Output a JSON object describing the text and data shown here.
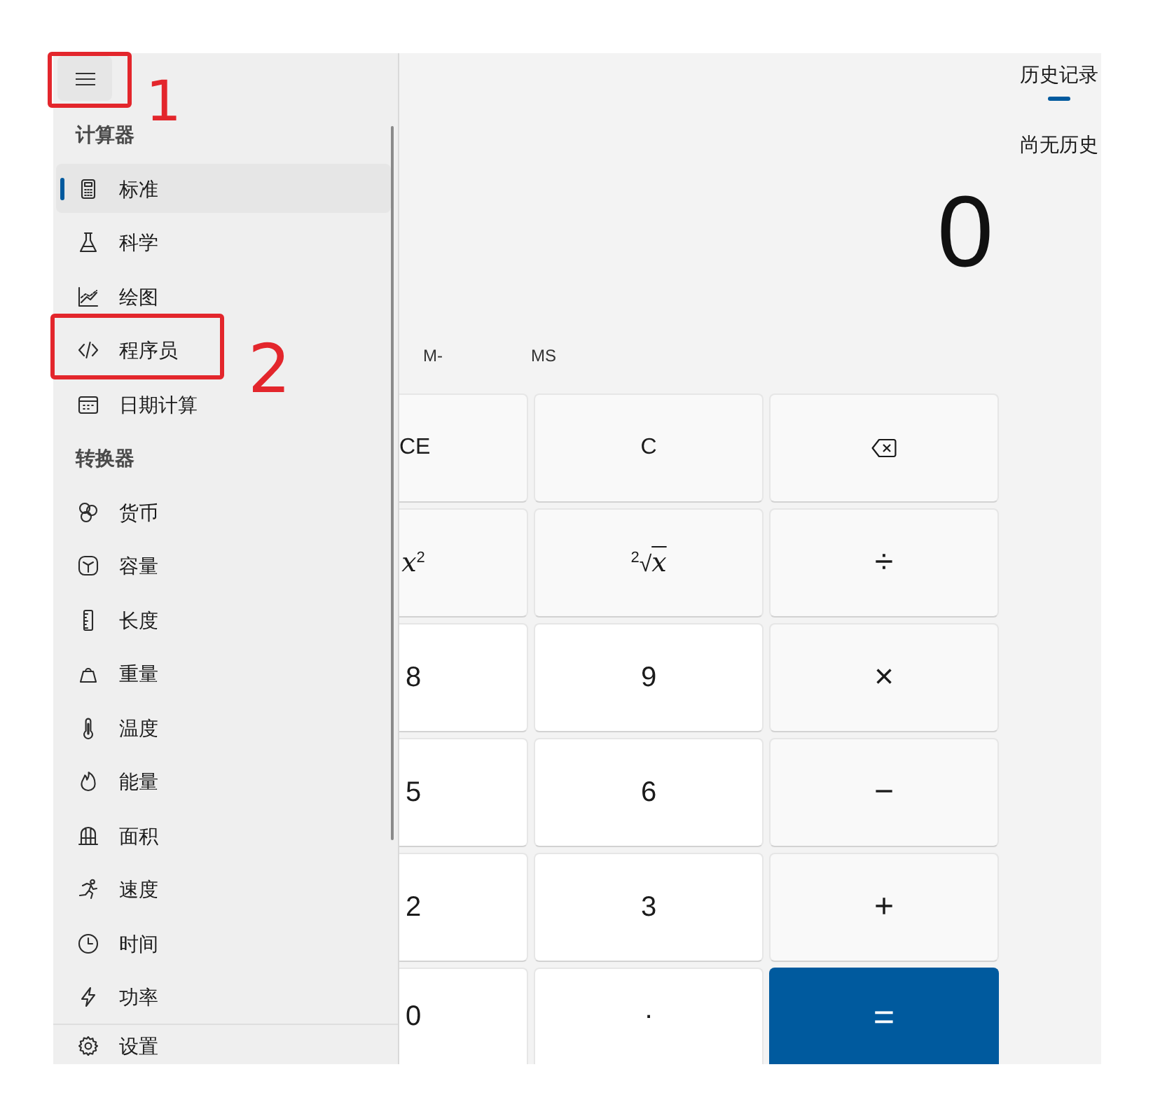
{
  "nav": {
    "menu_button": {
      "annotation": "1"
    },
    "sections": [
      {
        "title": "计算器",
        "items": [
          {
            "label": "标准",
            "selected": true
          },
          {
            "label": "科学",
            "selected": false
          },
          {
            "label": "绘图",
            "selected": false
          },
          {
            "label": "程序员",
            "selected": false,
            "annotation": "2"
          },
          {
            "label": "日期计算",
            "selected": false
          }
        ]
      },
      {
        "title": "转换器",
        "items": [
          {
            "label": "货币",
            "selected": false
          },
          {
            "label": "容量",
            "selected": false
          },
          {
            "label": "长度",
            "selected": false
          },
          {
            "label": "重量",
            "selected": false
          },
          {
            "label": "温度",
            "selected": false
          },
          {
            "label": "能量",
            "selected": false
          },
          {
            "label": "面积",
            "selected": false
          },
          {
            "label": "速度",
            "selected": false
          },
          {
            "label": "时间",
            "selected": false
          },
          {
            "label": "功率",
            "selected": false
          }
        ]
      }
    ],
    "footer_item": {
      "label": "设置"
    }
  },
  "display": {
    "value": "0"
  },
  "memory": [
    "M-",
    "MS"
  ],
  "keypad": [
    {
      "label": "CE",
      "kind": "function"
    },
    {
      "label": "C",
      "kind": "function"
    },
    {
      "kind": "backspace"
    },
    {
      "label": "*x*$^{2}$",
      "kind": "function"
    },
    {
      "label": "$^{2}$√*x*",
      "kind": "function"
    },
    {
      "label": "÷",
      "kind": "operator"
    },
    {
      "label": "8",
      "kind": "digit"
    },
    {
      "label": "9",
      "kind": "digit"
    },
    {
      "label": "×",
      "kind": "operator"
    },
    {
      "label": "5",
      "kind": "digit"
    },
    {
      "label": "6",
      "kind": "digit"
    },
    {
      "label": "−",
      "kind": "operator"
    },
    {
      "label": "2",
      "kind": "digit"
    },
    {
      "label": "3",
      "kind": "digit"
    },
    {
      "label": "+",
      "kind": "operator"
    },
    {
      "label": "0",
      "kind": "digit"
    },
    {
      "label": ".",
      "kind": "digit"
    },
    {
      "label": "=",
      "kind": "equals"
    }
  ],
  "history": {
    "tabs": [
      {
        "label": "历史记录",
        "selected": true
      }
    ],
    "empty_text": "尚无历史"
  }
}
